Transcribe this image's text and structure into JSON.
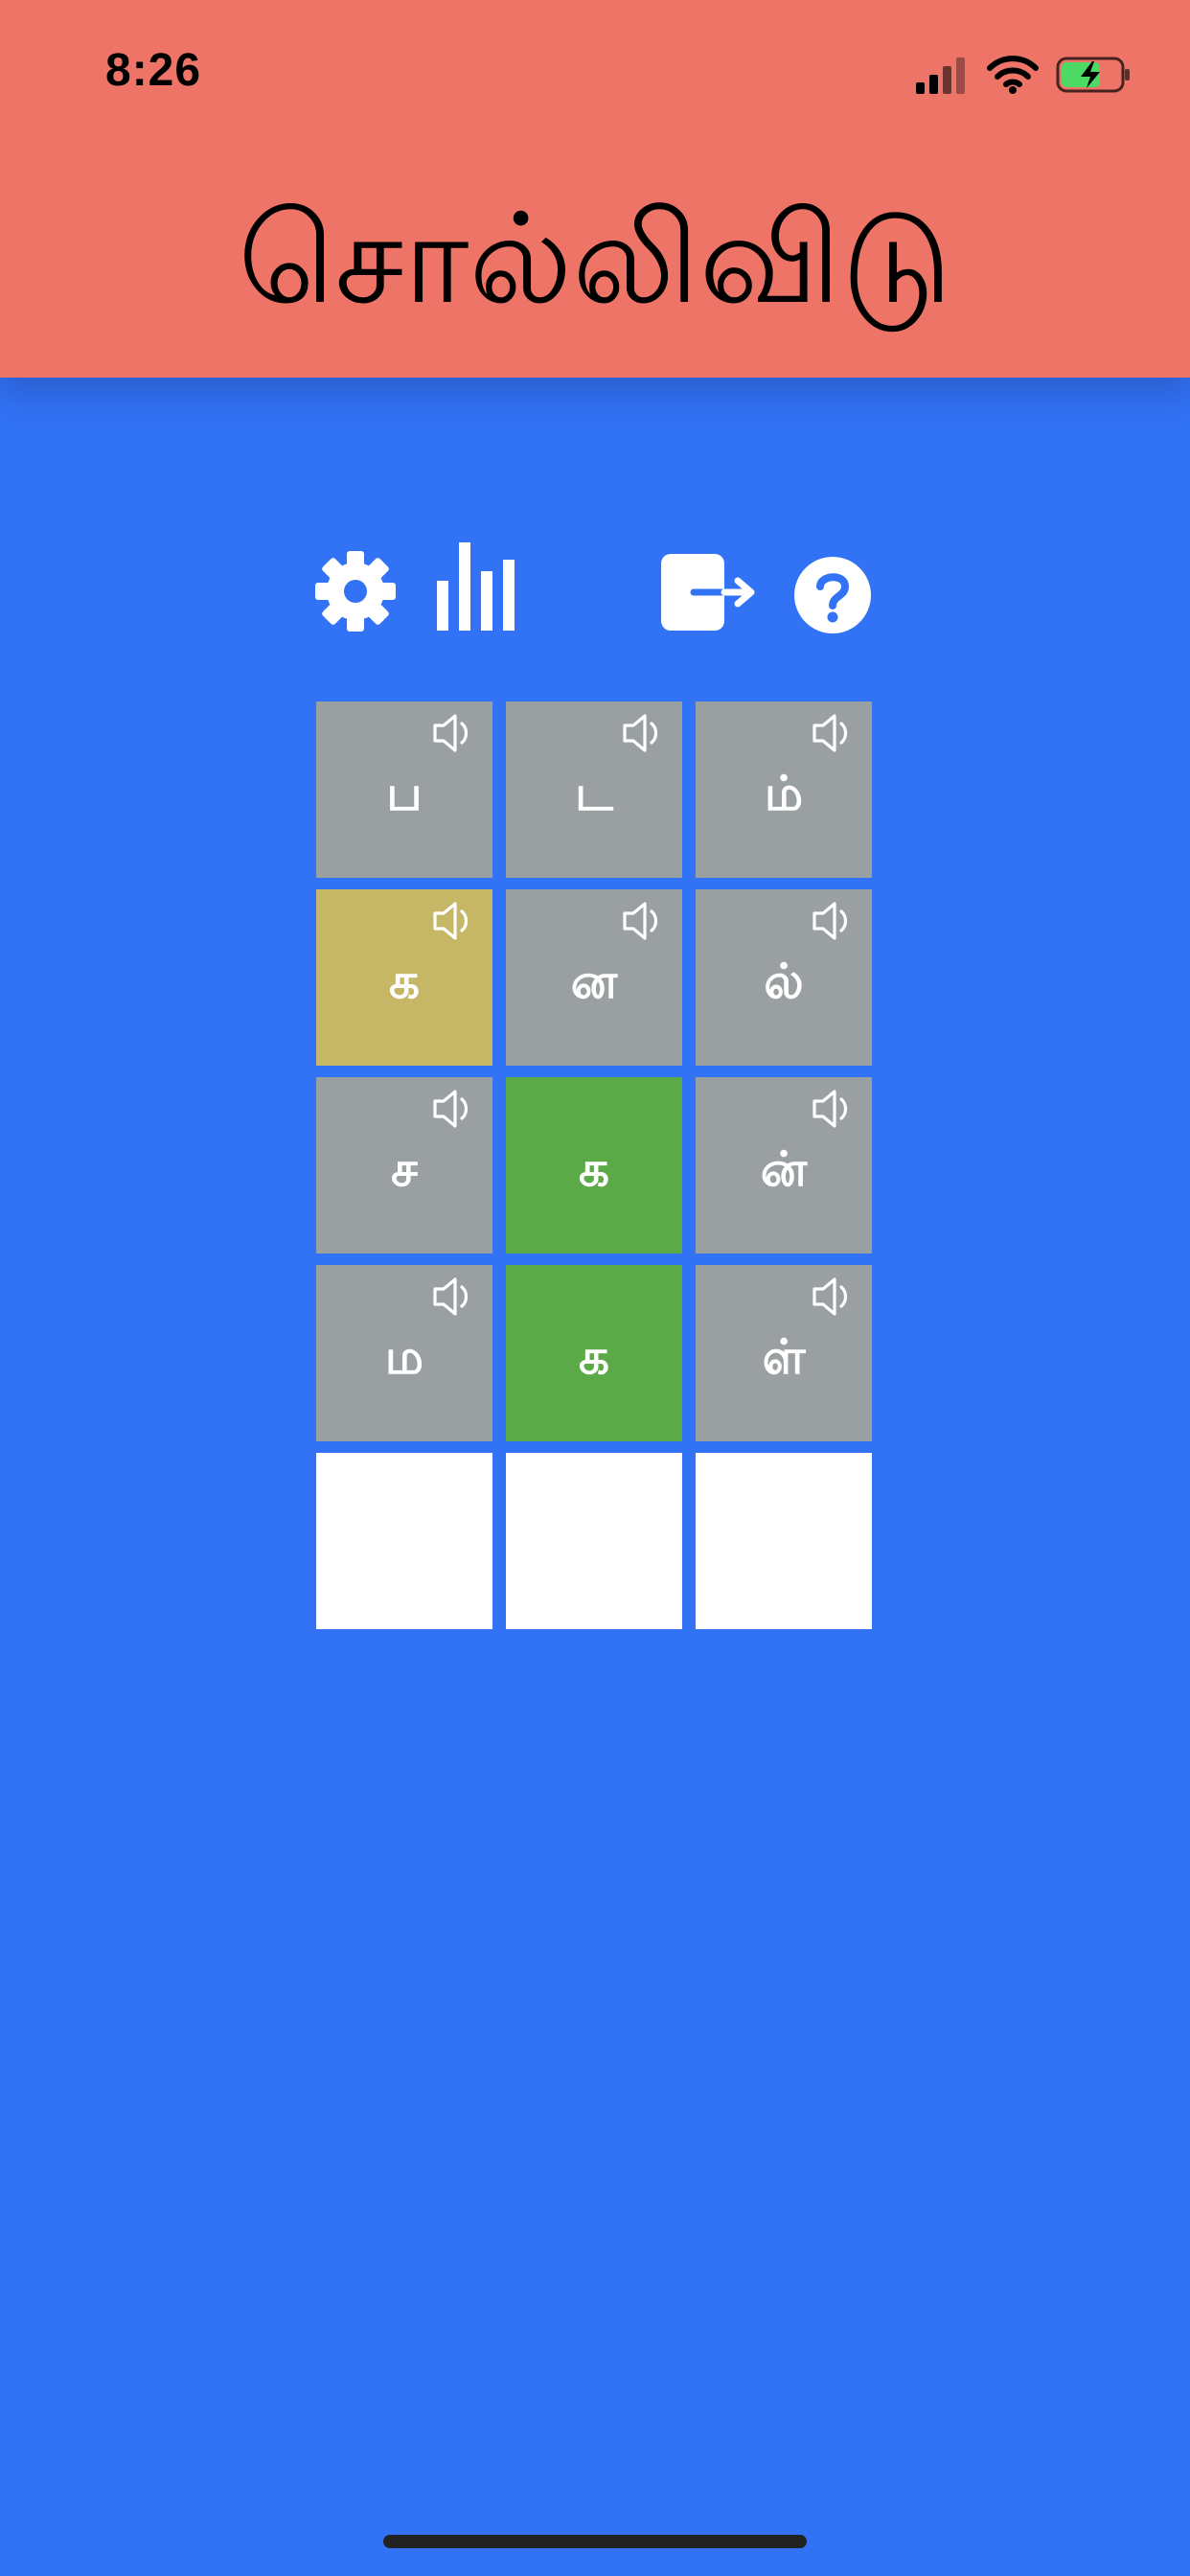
{
  "status_bar": {
    "time": "8:26",
    "icons": [
      "signal-icon",
      "wifi-icon",
      "battery-charging-icon"
    ]
  },
  "header": {
    "title": "சொல்லிவிடு",
    "background": "#EE7468"
  },
  "toolbar": {
    "icons": [
      "gear-icon",
      "stats-icon",
      "exit-icon",
      "help-icon"
    ]
  },
  "colors": {
    "background": "#3272F5",
    "gray": "#9A9FA1",
    "present": "#C6B767",
    "correct": "#5CAA47",
    "empty": "#FFFFFF"
  },
  "board": {
    "rows": [
      [
        {
          "letter": "ப",
          "state": "absent",
          "speaker": true
        },
        {
          "letter": "ட",
          "state": "absent",
          "speaker": true
        },
        {
          "letter": "ம்",
          "state": "absent",
          "speaker": true
        }
      ],
      [
        {
          "letter": "க",
          "state": "present",
          "speaker": true
        },
        {
          "letter": "ன",
          "state": "absent",
          "speaker": true
        },
        {
          "letter": "ல்",
          "state": "absent",
          "speaker": true
        }
      ],
      [
        {
          "letter": "ச",
          "state": "absent",
          "speaker": true
        },
        {
          "letter": "க",
          "state": "correct",
          "speaker": false
        },
        {
          "letter": "ன்",
          "state": "absent",
          "speaker": true
        }
      ],
      [
        {
          "letter": "ம",
          "state": "absent",
          "speaker": true
        },
        {
          "letter": "க",
          "state": "correct",
          "speaker": false
        },
        {
          "letter": "ள்",
          "state": "absent",
          "speaker": true
        }
      ],
      [
        {
          "letter": "",
          "state": "empty",
          "speaker": false
        },
        {
          "letter": "",
          "state": "empty",
          "speaker": false
        },
        {
          "letter": "",
          "state": "empty",
          "speaker": false
        }
      ]
    ]
  }
}
